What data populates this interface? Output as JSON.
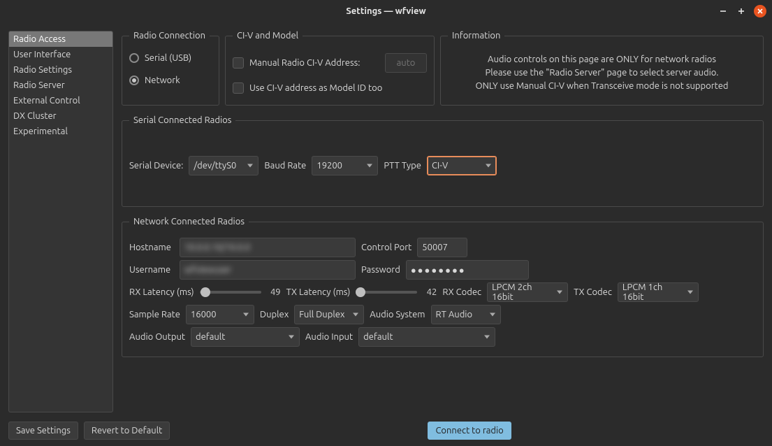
{
  "window": {
    "title": "Settings — wfview"
  },
  "sidebar": {
    "items": [
      {
        "label": "Radio Access",
        "active": true
      },
      {
        "label": "User Interface"
      },
      {
        "label": "Radio Settings"
      },
      {
        "label": "Radio Server"
      },
      {
        "label": "External Control"
      },
      {
        "label": "DX Cluster"
      },
      {
        "label": "Experimental"
      }
    ]
  },
  "groups": {
    "connection": {
      "legend": "Radio Connection",
      "serial_label": "Serial (USB)",
      "network_label": "Network",
      "selected": "network"
    },
    "civ": {
      "legend": "CI-V and Model",
      "manual_label": "Manual Radio CI-V Address:",
      "auto_placeholder": "auto",
      "use_as_model_label": "Use CI-V address as Model ID too"
    },
    "info": {
      "legend": "Information",
      "line1": "Audio controls on this page are ONLY for network radios",
      "line2": "Please use the \"Radio Server\" page to select server audio.",
      "line3": "ONLY use Manual CI-V when Transceive mode is not supported"
    },
    "serial": {
      "legend": "Serial Connected Radios",
      "device_label": "Serial Device:",
      "device_value": "/dev/ttyS0",
      "baud_label": "Baud Rate",
      "baud_value": "19200",
      "ptt_label": "PTT Type",
      "ptt_value": "CI-V"
    },
    "network": {
      "legend": "Network Connected Radios",
      "hostname_label": "Hostname",
      "hostname_value": "10.0.0.10/10.0.0",
      "controlport_label": "Control Port",
      "controlport_value": "50007",
      "username_label": "Username",
      "username_value": "wfviewuser",
      "password_label": "Password",
      "password_value": "●●●●●●●●",
      "rxlat_label": "RX Latency (ms)",
      "rxlat_value": "49",
      "txlat_label": "TX Latency (ms)",
      "txlat_value": "42",
      "rxcodec_label": "RX Codec",
      "rxcodec_value": "LPCM 2ch 16bit",
      "txcodec_label": "TX Codec",
      "txcodec_value": "LPCM 1ch 16bit",
      "samplerate_label": "Sample Rate",
      "samplerate_value": "16000",
      "duplex_label": "Duplex",
      "duplex_value": "Full Duplex",
      "audiosystem_label": "Audio System",
      "audiosystem_value": "RT Audio",
      "audioout_label": "Audio Output",
      "audioout_value": "default",
      "audioin_label": "Audio Input",
      "audioin_value": "default"
    }
  },
  "footer": {
    "save": "Save Settings",
    "revert": "Revert to Default",
    "connect": "Connect to radio"
  }
}
